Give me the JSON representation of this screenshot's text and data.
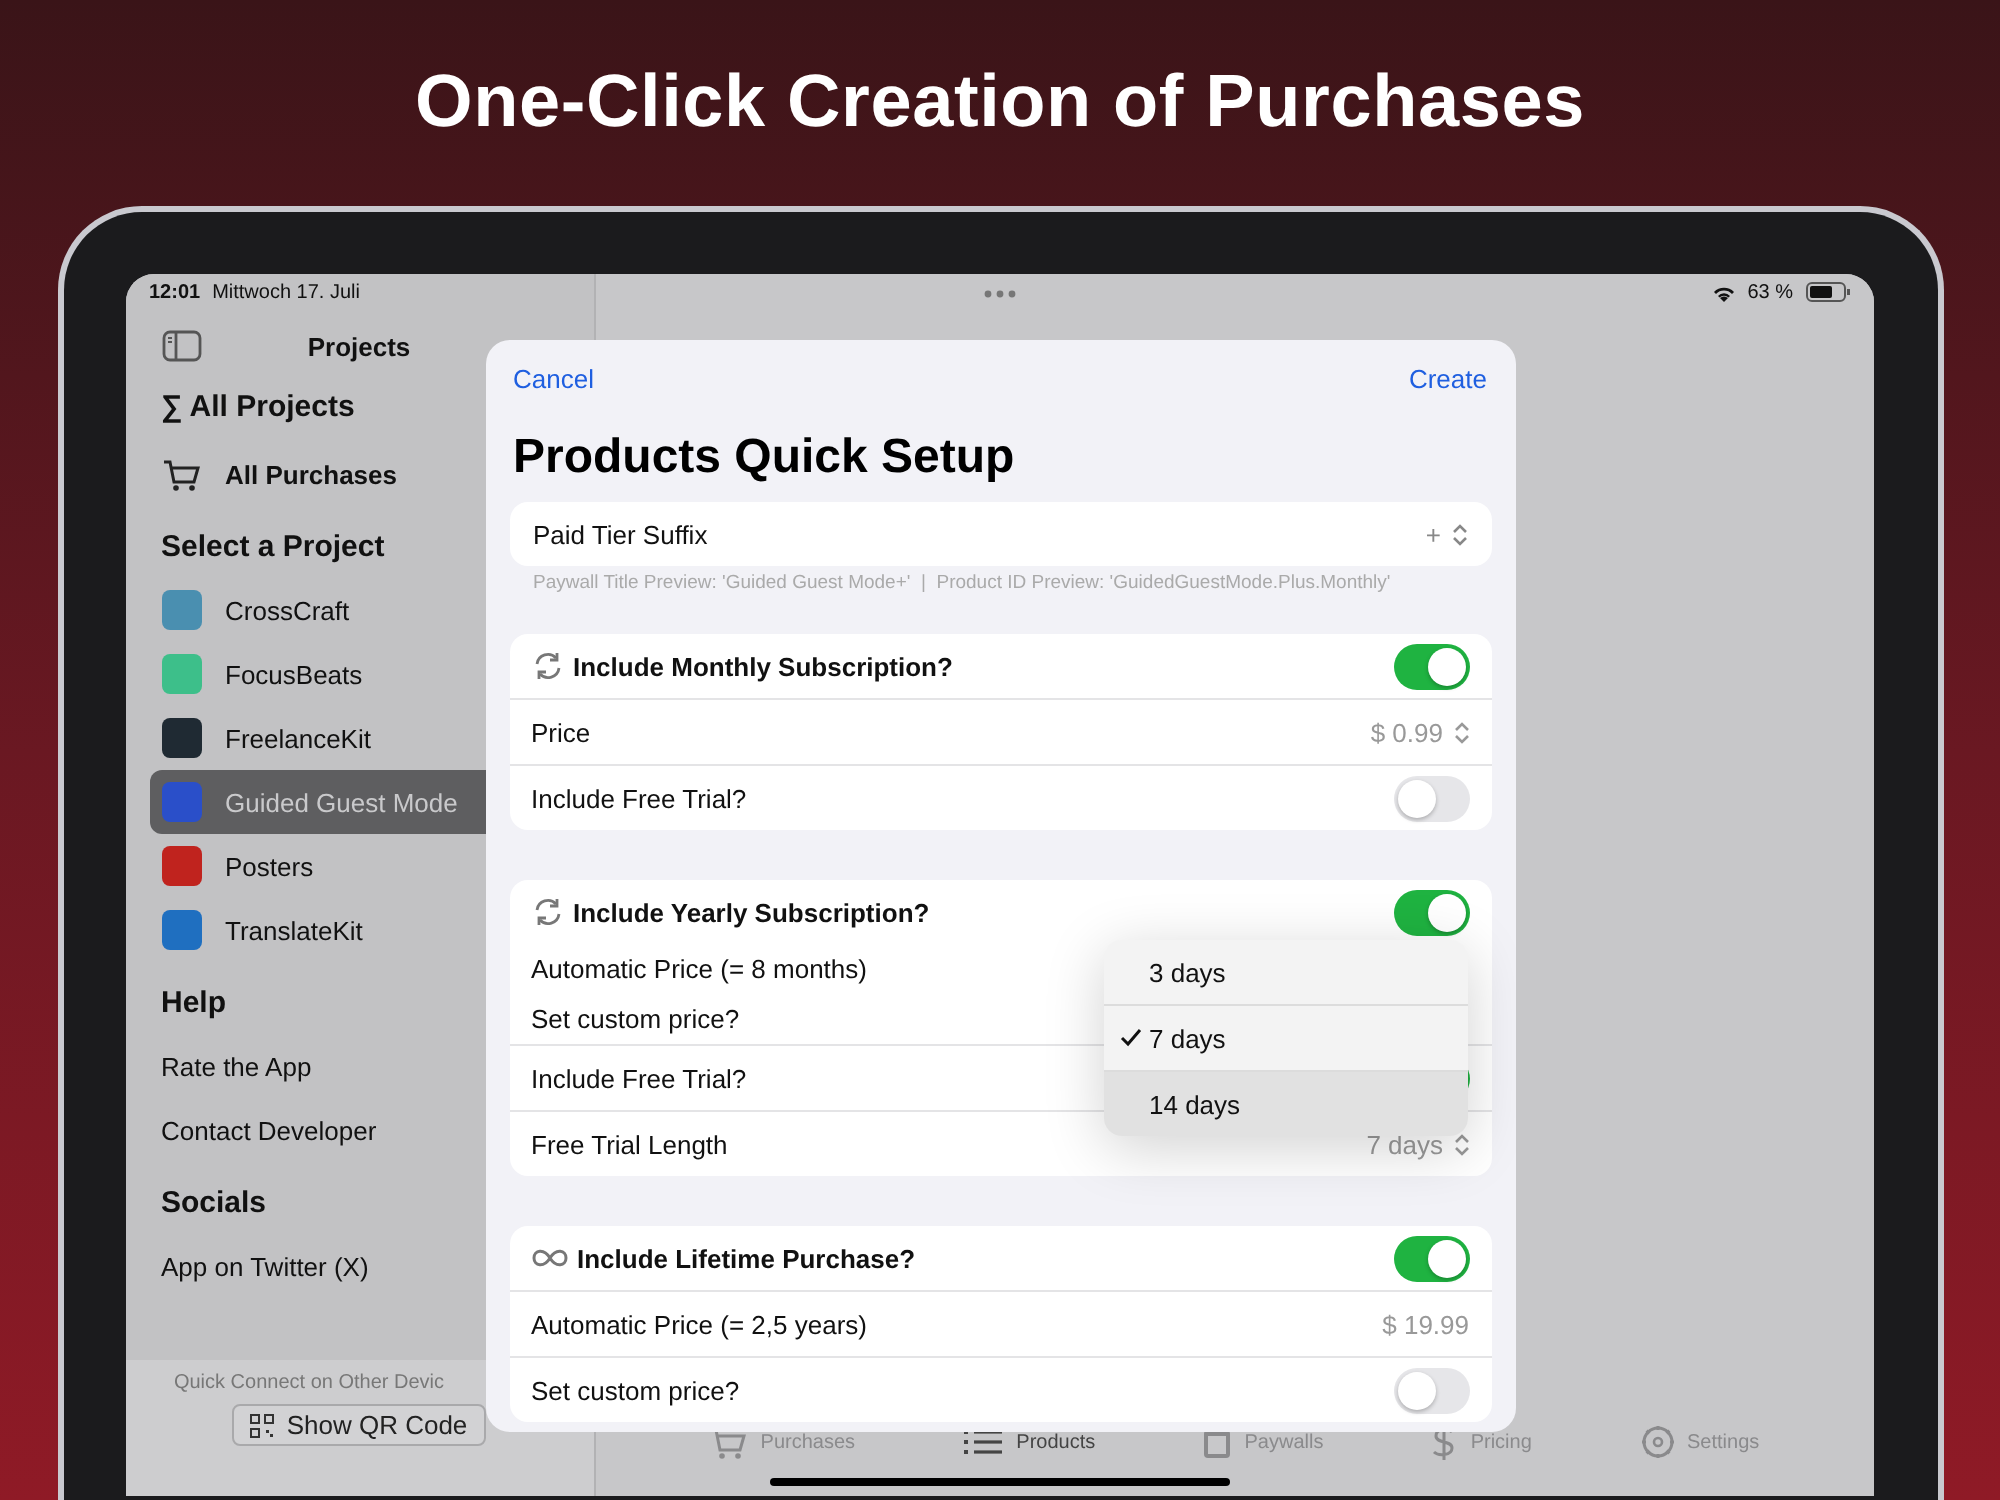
{
  "headline": "One-Click Creation of Purchases",
  "status_bar": {
    "time": "12:01",
    "date": "Mittwoch 17. Juli",
    "battery": "63 %"
  },
  "sidebar": {
    "title": "Projects",
    "top_items": [
      {
        "label": "∑ All Projects",
        "kind": "heading"
      },
      {
        "label": "All Purchases",
        "kind": "cart"
      }
    ],
    "sections": [
      {
        "title": "Select a Project",
        "items": [
          {
            "label": "CrossCraft",
            "color": "#4a8fb0",
            "selected": false
          },
          {
            "label": "FocusBeats",
            "color": "#3dbf8a",
            "selected": false
          },
          {
            "label": "FreelanceKit",
            "color": "#1f2a33",
            "selected": false
          },
          {
            "label": "Guided Guest Mode",
            "color": "#2a4fc9",
            "selected": true
          },
          {
            "label": "Posters",
            "color": "#c0231e",
            "selected": false
          },
          {
            "label": "TranslateKit",
            "color": "#1f6fc0",
            "selected": false
          }
        ]
      },
      {
        "title": "Help",
        "items": [
          {
            "label": "Rate the App",
            "selected": false
          },
          {
            "label": "Contact Developer",
            "selected": false
          }
        ]
      },
      {
        "title": "Socials",
        "items": [
          {
            "label": "App on Twitter (X)",
            "selected": false
          }
        ]
      }
    ],
    "footer": {
      "caption": "Quick Connect on Other Devic",
      "button": "Show QR Code"
    }
  },
  "sheet": {
    "cancel": "Cancel",
    "create": "Create",
    "title": "Products Quick Setup",
    "suffix": {
      "label": "Paid Tier Suffix",
      "value": "+"
    },
    "caption": "Paywall Title Preview: 'Guided Guest Mode+'  |  Product ID Preview: 'GuidedGuestMode.Plus.Monthly'",
    "sections": [
      {
        "kind": "subscription",
        "title": "Include Monthly Subscription?",
        "on": true,
        "rows": [
          {
            "kind": "value",
            "label": "Price",
            "value": "$ 0.99",
            "stepper": true
          },
          {
            "kind": "toggle",
            "label": "Include Free Trial?",
            "on": false
          }
        ]
      },
      {
        "kind": "subscription",
        "title": "Include Yearly Subscription?",
        "on": true,
        "rows": [
          {
            "kind": "label",
            "label": "Automatic Price (= 8 months)"
          },
          {
            "kind": "label",
            "label": "Set custom price?"
          },
          {
            "kind": "toggle",
            "label": "Include Free Trial?",
            "on": true
          },
          {
            "kind": "value",
            "label": "Free Trial Length",
            "value": "7 days",
            "stepper": true
          }
        ]
      },
      {
        "kind": "lifetime",
        "title": "Include Lifetime Purchase?",
        "on": true,
        "rows": [
          {
            "kind": "value",
            "label": "Automatic Price (= 2,5 years)",
            "value": "$ 19.99",
            "stepper": false
          },
          {
            "kind": "toggle",
            "label": "Set custom price?",
            "on": false
          }
        ]
      }
    ],
    "menu": [
      {
        "label": "3 days",
        "selected": false
      },
      {
        "label": "7 days",
        "selected": true
      },
      {
        "label": "14 days",
        "selected": false
      }
    ]
  },
  "tab_bar": [
    {
      "label": "Purchases",
      "selected": false
    },
    {
      "label": "Products",
      "selected": true
    },
    {
      "label": "Paywalls",
      "selected": false
    },
    {
      "label": "Pricing",
      "selected": false
    },
    {
      "label": "Settings",
      "selected": false
    }
  ]
}
